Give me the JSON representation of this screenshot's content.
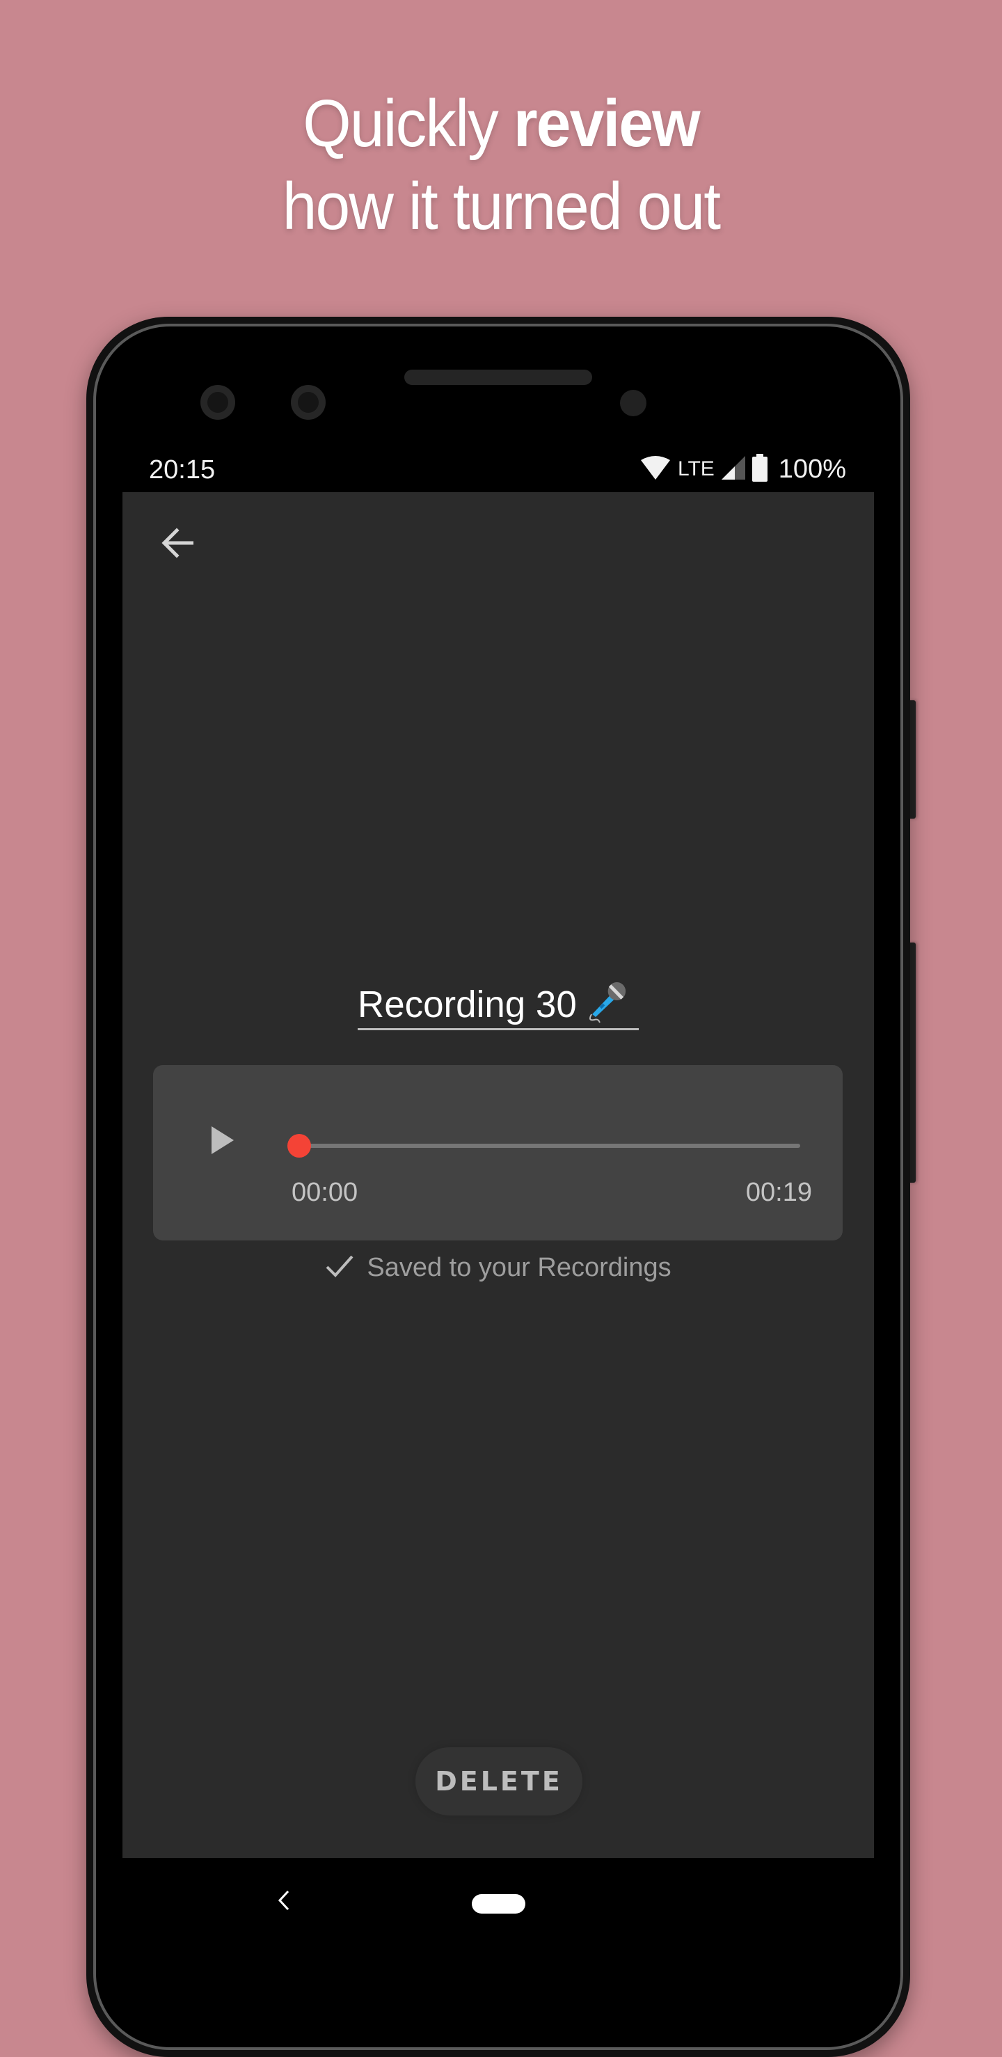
{
  "headline": {
    "line1_light": "Quickly ",
    "line1_bold": "review",
    "line2": "how it turned out"
  },
  "colors": {
    "background": "#c8878f",
    "screen": "#2b2b2b",
    "card": "#434343",
    "accent": "#f44336"
  },
  "status_bar": {
    "time": "20:15",
    "network": "LTE",
    "battery": "100%",
    "icons": [
      "wifi-icon",
      "signal-icon",
      "battery-icon"
    ]
  },
  "toolbar": {
    "back_icon": "arrow-left-icon"
  },
  "recording": {
    "title": "Recording 30",
    "title_emoji": "microphone"
  },
  "player": {
    "play_icon": "play-icon",
    "current_time": "00:00",
    "duration": "00:19",
    "progress": 0
  },
  "saved_status": {
    "icon": "check-icon",
    "text": "Saved to your Recordings"
  },
  "actions": {
    "delete_label": "DELETE"
  },
  "nav_bar": {
    "back_icon": "nav-back-icon",
    "home_icon": "home-pill-icon"
  }
}
